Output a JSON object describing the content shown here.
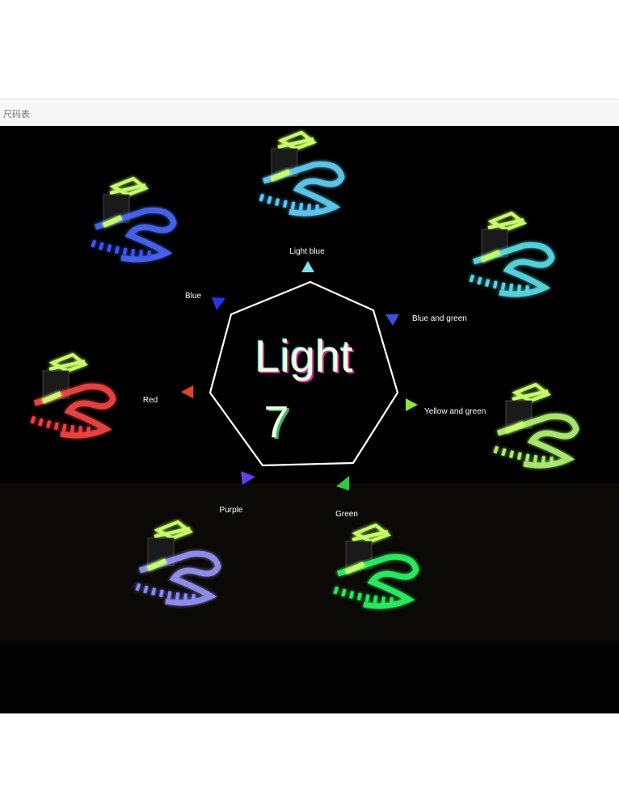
{
  "tab": {
    "label": "尺码表"
  },
  "banner": {
    "title": "Light",
    "count": "7",
    "colors": [
      {
        "label": "Light blue",
        "hex": "#7ee0f0"
      },
      {
        "label": "Blue and green",
        "hex": "#3b4fe0"
      },
      {
        "label": "Yellow and green",
        "hex": "#8ee33a"
      },
      {
        "label": "Green",
        "hex": "#2fcc3c"
      },
      {
        "label": "Purple",
        "hex": "#6a3de8"
      },
      {
        "label": "Red",
        "hex": "#e0442c"
      },
      {
        "label": "Blue",
        "hex": "#2236e8"
      }
    ],
    "shoe_glow": {
      "light_blue": "#68d8ff",
      "cyan": "#5fe6f2",
      "yellow_green": "#b9ff7a",
      "green": "#2fff6a",
      "purple": "#9d9cff",
      "red": "#ff4a4a",
      "blue": "#4d6cff"
    }
  }
}
